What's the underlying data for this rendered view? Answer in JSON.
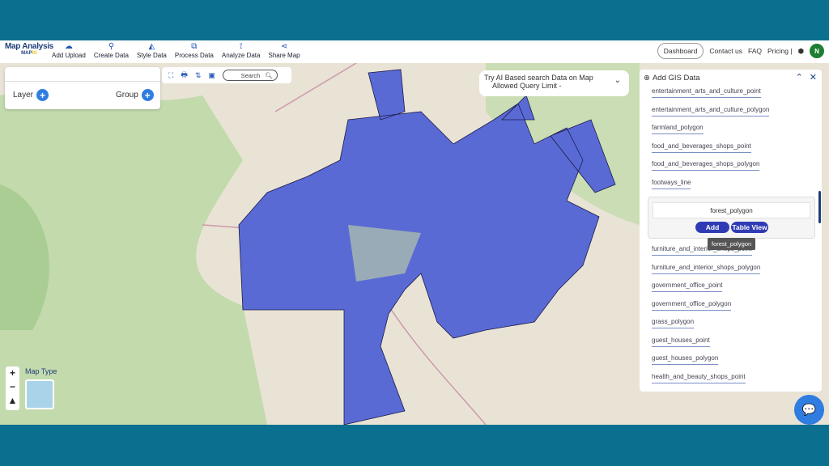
{
  "header": {
    "logo_title": "Map Analysis",
    "logo_sub": "MAP",
    "logo_sub2": "IG",
    "nav": [
      {
        "label": "Add Upload",
        "icon": "cloud-upload-icon"
      },
      {
        "label": "Create Data",
        "icon": "location-pin-icon"
      },
      {
        "label": "Style Data",
        "icon": "paint-bucket-icon"
      },
      {
        "label": "Process Data",
        "icon": "process-icon"
      },
      {
        "label": "Analyze Data",
        "icon": "analyze-icon"
      },
      {
        "label": "Share Map",
        "icon": "share-icon"
      }
    ],
    "dashboard": "Dashboard",
    "contact": "Contact us",
    "faq": "FAQ",
    "pricing": "Pricing |",
    "avatar": "N"
  },
  "layer_panel": {
    "layer": "Layer",
    "group": "Group"
  },
  "toolbar": {
    "search": "Search"
  },
  "ai_search": {
    "line1": "Try AI Based search Data on Map",
    "line2": "Allowed Query Limit -"
  },
  "gis_panel": {
    "title": "Add GIS Data",
    "items_before": [
      "entertainment_arts_and_culture_point",
      "entertainment_arts_and_culture_polygon",
      "farmland_polygon",
      "food_and_beverages_shops_point",
      "food_and_beverages_shops_polygon",
      "footways_line"
    ],
    "selected": {
      "name": "forest_polygon",
      "add": "Add",
      "table_view": "Table View",
      "tooltip": "forest_polygon"
    },
    "items_after": [
      "furniture_and_interior_shops_point",
      "furniture_and_interior_shops_polygon",
      "government_office_point",
      "government_office_polygon",
      "grass_polygon",
      "guest_houses_point",
      "guest_houses_polygon",
      "health_and_beauty_shops_point"
    ]
  },
  "map": {
    "map_type": "Map Type",
    "polygon_color": "#5a6ad4"
  },
  "colors": {
    "frame": "#0b6f8f",
    "accent": "#2f3bb5"
  }
}
